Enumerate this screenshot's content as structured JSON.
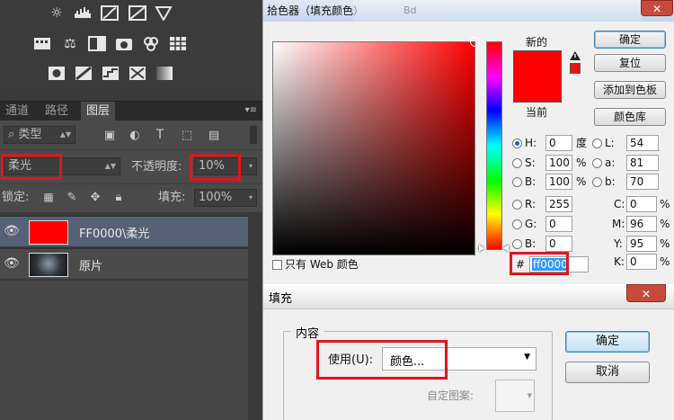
{
  "layers_panel": {
    "tabs": [
      "通道",
      "路径",
      "图层"
    ],
    "filter_kind": "类型",
    "blend_mode": "柔光",
    "opacity_label": "不透明度:",
    "opacity_value": "10%",
    "lock_label": "锁定:",
    "fill_label": "填充:",
    "fill_value": "100%",
    "layers": [
      {
        "name": "FF0000\\柔光",
        "thumb_color": "#ff0000",
        "selected": true
      },
      {
        "name": "原片",
        "thumb_color": "#33383d",
        "selected": false
      }
    ]
  },
  "color_picker": {
    "title": "拾色器（填充颜色）",
    "new_label": "新的",
    "current_label": "当前",
    "new_color": "#ff0000",
    "current_color": "#ff0000",
    "buttons": {
      "ok": "确定",
      "reset": "复位",
      "add_to_swatches": "添加到色板",
      "color_libraries": "颜色库"
    },
    "web_only_label": "只有 Web 颜色",
    "hsb": {
      "H": "0",
      "S": "100",
      "B": "100",
      "h_unit": "度",
      "pct": "%"
    },
    "rgb": {
      "R": "255",
      "G": "0",
      "B": "0"
    },
    "lab": {
      "L": "54",
      "a": "81",
      "b": "70"
    },
    "cmyk": {
      "C": "0",
      "M": "96",
      "Y": "95",
      "K": "0"
    },
    "hex_prefix": "#",
    "hex": "ff0000",
    "behind_tab_text": "Bd"
  },
  "fill_dialog": {
    "title": "填充",
    "group_label": "内容",
    "use_label": "使用(U):",
    "use_value": "颜色...",
    "custom_pattern_label": "自定图案:",
    "ok": "确定",
    "cancel": "取消"
  }
}
